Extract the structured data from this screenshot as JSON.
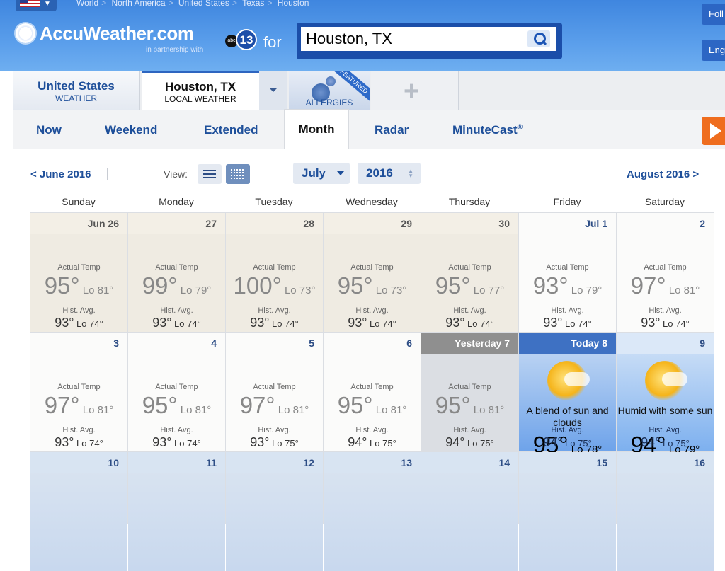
{
  "breadcrumb": [
    "World",
    "North America",
    "United States",
    "Texas",
    "Houston"
  ],
  "brand": {
    "name": "AccuWeather.com",
    "partner": "in partnership with",
    "station": "13",
    "station_net": "abc",
    "for": "for"
  },
  "search": {
    "value": "Houston, TX"
  },
  "right_buttons": {
    "follow": "Foll",
    "english": "Eng"
  },
  "location_tabs": [
    {
      "title": "United States",
      "subtitle": "WEATHER"
    },
    {
      "title": "Houston, TX",
      "subtitle": "LOCAL WEATHER"
    },
    {
      "title": "ALLERGIES",
      "badge": "FEATURED"
    }
  ],
  "nav_tabs": [
    "Now",
    "Weekend",
    "Extended",
    "Month",
    "Radar",
    "MinuteCast"
  ],
  "nav_reg": "®",
  "calendar_controls": {
    "prev": "< June 2016",
    "next": "August 2016 >",
    "view_label": "View:",
    "month": "July",
    "year": "2016"
  },
  "days_of_week": [
    "Sunday",
    "Monday",
    "Tuesday",
    "Wednesday",
    "Thursday",
    "Friday",
    "Saturday"
  ],
  "labels": {
    "actual": "Actual Temp",
    "hist": "Hist. Avg.",
    "lo": "Lo",
    "deg": "°"
  },
  "weeks": [
    [
      {
        "date": "Jun 26",
        "hi": "95",
        "lo": "81",
        "hhi": "93",
        "hlo": "74",
        "kind": "past"
      },
      {
        "date": "27",
        "hi": "99",
        "lo": "79",
        "hhi": "93",
        "hlo": "74",
        "kind": "past"
      },
      {
        "date": "28",
        "hi": "100",
        "lo": "73",
        "hhi": "93",
        "hlo": "74",
        "kind": "past"
      },
      {
        "date": "29",
        "hi": "95",
        "lo": "73",
        "hhi": "93",
        "hlo": "74",
        "kind": "past"
      },
      {
        "date": "30",
        "hi": "95",
        "lo": "77",
        "hhi": "93",
        "hlo": "74",
        "kind": "past"
      },
      {
        "date": "Jul 1",
        "hi": "93",
        "lo": "79",
        "hhi": "93",
        "hlo": "74",
        "kind": "fut"
      },
      {
        "date": "2",
        "hi": "97",
        "lo": "81",
        "hhi": "93",
        "hlo": "74",
        "kind": "fut"
      }
    ],
    [
      {
        "date": "3",
        "hi": "97",
        "lo": "81",
        "hhi": "93",
        "hlo": "74",
        "kind": "fut"
      },
      {
        "date": "4",
        "hi": "95",
        "lo": "81",
        "hhi": "93",
        "hlo": "74",
        "kind": "fut"
      },
      {
        "date": "5",
        "hi": "97",
        "lo": "81",
        "hhi": "93",
        "hlo": "75",
        "kind": "fut"
      },
      {
        "date": "6",
        "hi": "95",
        "lo": "81",
        "hhi": "94",
        "hlo": "75",
        "kind": "fut"
      },
      {
        "date": "Yesterday 7",
        "hi": "95",
        "lo": "81",
        "hhi": "94",
        "hlo": "75",
        "kind": "yest"
      },
      {
        "date": "Today 8",
        "hi": "95",
        "lo": "78",
        "hhi": "94",
        "hlo": "75",
        "kind": "today",
        "cond": "A blend of sun and clouds"
      },
      {
        "date": "9",
        "hi": "94",
        "lo": "79",
        "hhi": "94",
        "hlo": "75",
        "kind": "fblue",
        "cond": "Humid with some sun"
      }
    ],
    [
      {
        "date": "10"
      },
      {
        "date": "11"
      },
      {
        "date": "12"
      },
      {
        "date": "13"
      },
      {
        "date": "14"
      },
      {
        "date": "15"
      },
      {
        "date": "16"
      }
    ]
  ]
}
